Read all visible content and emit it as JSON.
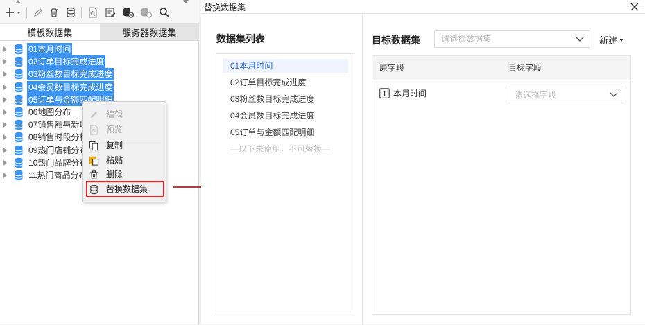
{
  "left_panel": {
    "tabs": [
      {
        "label": "模板数据集",
        "active": true
      },
      {
        "label": "服务器数据集",
        "active": false
      }
    ],
    "tree_items": [
      {
        "label": "01本月时间",
        "selected": true
      },
      {
        "label": "02订单目标完成进度",
        "selected": true
      },
      {
        "label": "03粉丝数目标完成进度",
        "selected": true
      },
      {
        "label": "04会员数目标完成进度",
        "selected": true
      },
      {
        "label": "05订单与金额匹配明细",
        "selected": true
      },
      {
        "label": "06地图分布",
        "selected": false
      },
      {
        "label": "07销售额与新增",
        "selected": false
      },
      {
        "label": "08销售时段分析",
        "selected": false
      },
      {
        "label": "09热门店铺分布",
        "selected": false
      },
      {
        "label": "10热门品牌分布",
        "selected": false
      },
      {
        "label": "11热门商品分布",
        "selected": false
      }
    ]
  },
  "context_menu": {
    "items": [
      {
        "label": "编辑",
        "icon": "pencil-icon",
        "disabled": true
      },
      {
        "label": "预览",
        "icon": "preview-icon",
        "disabled": true
      },
      {
        "label": "复制",
        "icon": "copy-icon",
        "disabled": false
      },
      {
        "label": "粘贴",
        "icon": "paste-icon",
        "disabled": false
      },
      {
        "label": "删除",
        "icon": "trash-icon",
        "disabled": false
      },
      {
        "label": "替换数据集",
        "icon": "database-icon",
        "disabled": false
      }
    ]
  },
  "dialog": {
    "title": "替换数据集",
    "dataset_list": {
      "heading": "数据集列表",
      "items": [
        "01本月时间",
        "02订单目标完成进度",
        "03粉丝数目标完成进度",
        "04会员数目标完成进度",
        "05订单与金额匹配明细"
      ],
      "active_index": 0,
      "unused_note": "—以下未使用，不可替换—"
    },
    "target": {
      "heading": "目标数据集",
      "select_placeholder": "请选择数据集",
      "new_label": "新建",
      "columns": [
        "原字段",
        "目标字段"
      ],
      "rows": [
        {
          "source": "本月时间",
          "target_placeholder": "请选择字段"
        }
      ]
    }
  },
  "colors": {
    "selection": "#3d93f0",
    "active_text": "#2f6fdb",
    "highlight": "#e02a2a"
  }
}
